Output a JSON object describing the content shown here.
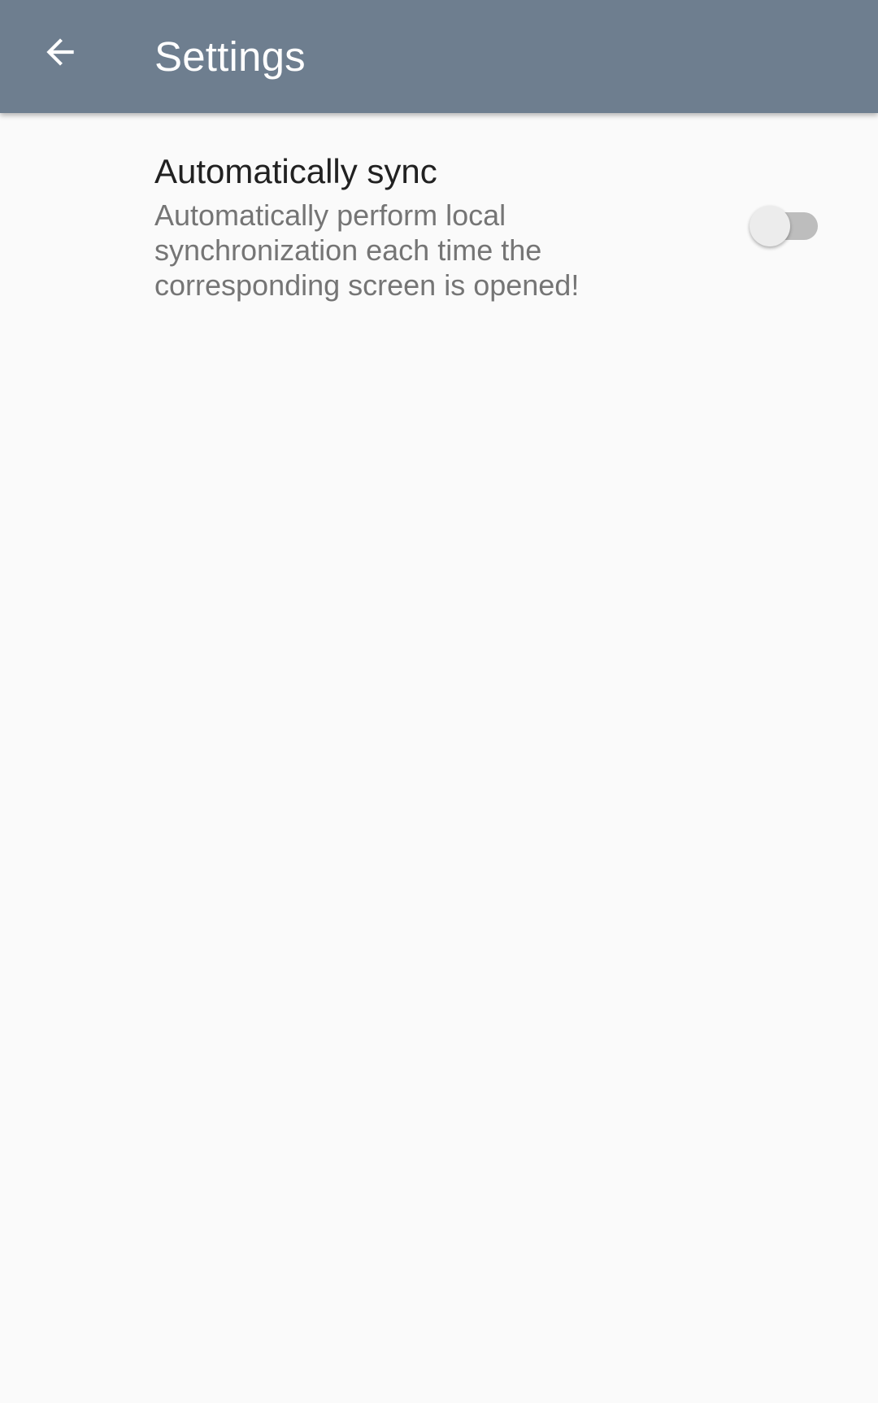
{
  "app_bar": {
    "title": "Settings",
    "back_icon": "arrow-back-icon",
    "background_color": "#6e7e8f"
  },
  "preferences": [
    {
      "title": "Automatically sync",
      "summary": "Automatically perform local synchronization each time the corresponding screen is opened!",
      "switch_on": false
    }
  ]
}
